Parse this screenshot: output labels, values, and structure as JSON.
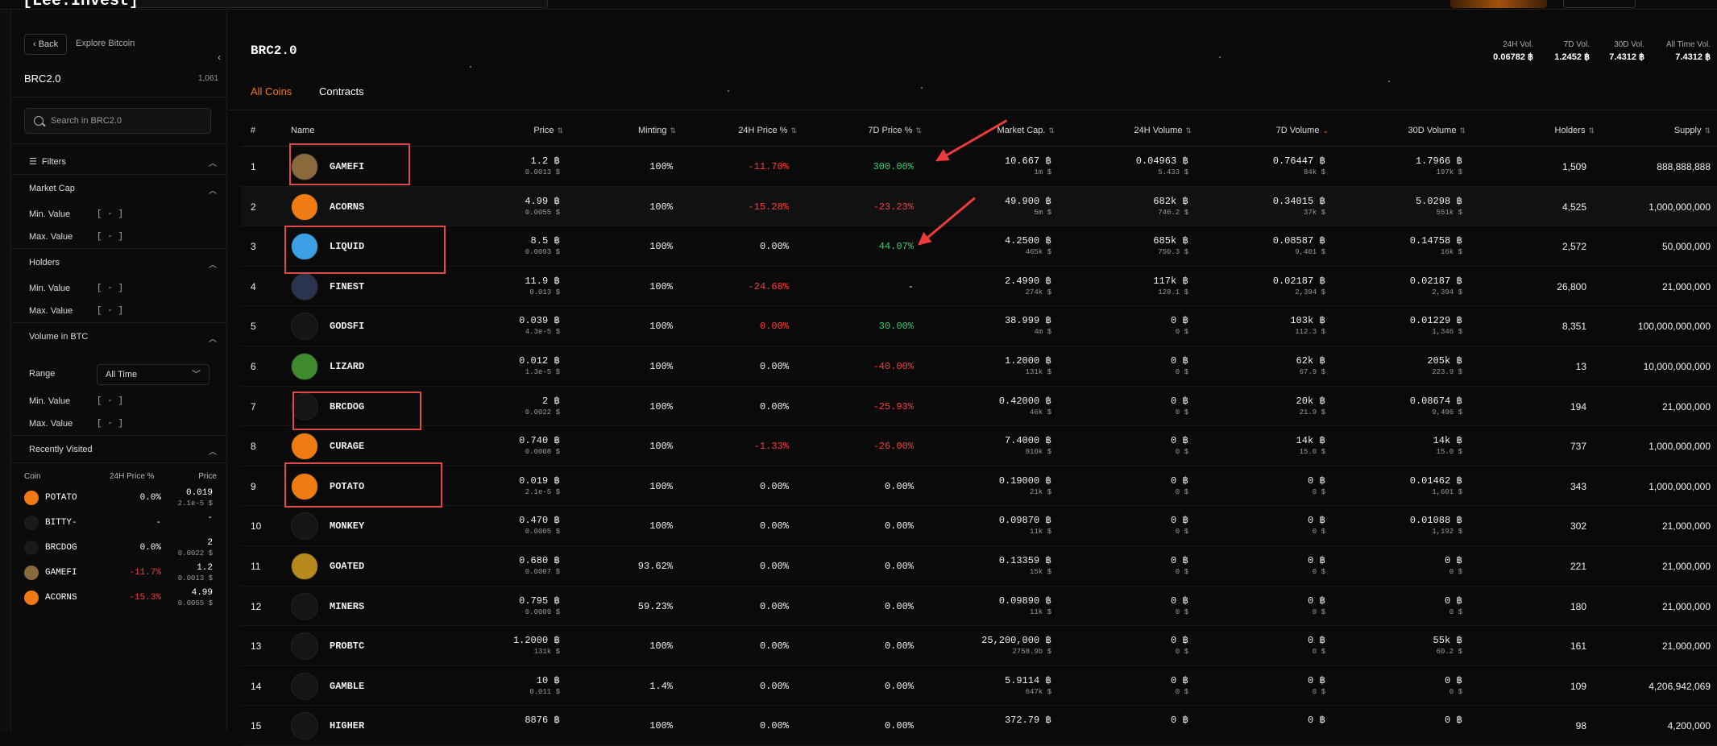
{
  "topbar": {
    "logo": "[Lee.Invest]"
  },
  "sidebar": {
    "back_label": "‹ Back",
    "explore_label": "Explore Bitcoin",
    "title": "BRC2.0",
    "count": "1,061",
    "search_placeholder": "Search in BRC2.0",
    "filters_label": "Filters",
    "market_cap_label": "Market Cap",
    "holders_label": "Holders",
    "volume_label": "Volume in BTC",
    "min_label": "Min. Value",
    "max_label": "Max. Value",
    "bracket_value": "[ - ]",
    "range_label": "Range",
    "range_value": "All Time",
    "recently_visited_label": "Recently Visited",
    "rv_headers": {
      "coin": "Coin",
      "pct": "24H Price %",
      "price": "Price"
    },
    "recent": [
      {
        "name": "POTATO",
        "pct": "0.0%",
        "price": "0.019",
        "sub": "2.1e-5 $",
        "icon_color": "#f07b12",
        "pct_color": "#ffffff"
      },
      {
        "name": "BITTY-",
        "pct": "-",
        "price": "-",
        "sub": "",
        "icon_color": "#1a1a1a",
        "pct_color": "#ffffff"
      },
      {
        "name": "BRCDOG",
        "pct": "0.0%",
        "price": "2",
        "sub": "0.0022 $",
        "icon_color": "#1a1a1a",
        "pct_color": "#ffffff"
      },
      {
        "name": "GAMEFI",
        "pct": "-11.7%",
        "price": "1.2",
        "sub": "0.0013 $",
        "icon_color": "#8a6a3c",
        "pct_color": "#ff3b3b"
      },
      {
        "name": "ACORNS",
        "pct": "-15.3%",
        "price": "4.99",
        "sub": "0.0055 $",
        "icon_color": "#f07b12",
        "pct_color": "#ff3b3b"
      }
    ]
  },
  "main": {
    "title": "BRC2.0",
    "stats": [
      {
        "label": "24H Vol.",
        "value": "0.06782 ฿"
      },
      {
        "label": "7D Vol.",
        "value": "1.2452 ฿"
      },
      {
        "label": "30D Vol.",
        "value": "7.4312 ฿"
      },
      {
        "label": "All Time Vol.",
        "value": "7.4312 ฿"
      }
    ],
    "tabs": [
      {
        "label": "All Coins"
      },
      {
        "label": "Contracts"
      }
    ],
    "headers": {
      "num": "#",
      "name": "Name",
      "price": "Price",
      "minting": "Minting",
      "p24": "24H Price %",
      "p7": "7D Price %",
      "mcap": "Market Cap.",
      "v24": "24H Volume",
      "v7": "7D Volume",
      "v30": "30D Volume",
      "holders": "Holders",
      "supply": "Supply"
    },
    "rows": [
      {
        "n": "1",
        "name": "GAMEFI",
        "price": "1.2 ฿",
        "price_sub": "0.0013 $",
        "mint": "100%",
        "p24": "-11.70%",
        "p24c": "red",
        "p7": "300.00%",
        "p7c": "green",
        "mcap": "10.667 ฿",
        "mcap_sub": "1m $",
        "v24": "0.04963 ฿",
        "v24_sub": "5.433 $",
        "v7": "0.76447 ฿",
        "v7_sub": "84k $",
        "v30": "1.7966 ฿",
        "v30_sub": "197k $",
        "holders": "1,509",
        "supply": "888,888,888",
        "icon": "#8a6a3c"
      },
      {
        "n": "2",
        "name": "ACORNS",
        "price": "4.99 ฿",
        "price_sub": "0.0055 $",
        "mint": "100%",
        "p24": "-15.28%",
        "p24c": "red",
        "p7": "-23.23%",
        "p7c": "red",
        "mcap": "49.900 ฿",
        "mcap_sub": "5m $",
        "v24": "682k ฿",
        "v24_sub": "746.2 $",
        "v7": "0.34015 ฿",
        "v7_sub": "37k $",
        "v30": "5.0298 ฿",
        "v30_sub": "551k $",
        "holders": "4,525",
        "supply": "1,000,000,000",
        "icon": "#f07b12"
      },
      {
        "n": "3",
        "name": "LIQUID",
        "price": "8.5 ฿",
        "price_sub": "0.0093 $",
        "mint": "100%",
        "p24": "0.00%",
        "p24c": "",
        "p7": "44.07%",
        "p7c": "green",
        "mcap": "4.2500 ฿",
        "mcap_sub": "465k $",
        "v24": "685k ฿",
        "v24_sub": "750.3 $",
        "v7": "0.08587 ฿",
        "v7_sub": "9,401 $",
        "v30": "0.14758 ฿",
        "v30_sub": "16k $",
        "holders": "2,572",
        "supply": "50,000,000",
        "icon": "#3ba0e6"
      },
      {
        "n": "4",
        "name": "FINEST",
        "price": "11.9 ฿",
        "price_sub": "0.013 $",
        "mint": "100%",
        "p24": "-24.68%",
        "p24c": "red",
        "p7": "-",
        "p7c": "",
        "mcap": "2.4990 ฿",
        "mcap_sub": "274k $",
        "v24": "117k ฿",
        "v24_sub": "128.1 $",
        "v7": "0.02187 ฿",
        "v7_sub": "2,394 $",
        "v30": "0.02187 ฿",
        "v30_sub": "2,394 $",
        "holders": "26,800",
        "supply": "21,000,000",
        "icon": "#2a3350"
      },
      {
        "n": "5",
        "name": "GODSFI",
        "price": "0.039 ฿",
        "price_sub": "4.3e-5 $",
        "mint": "100%",
        "p24": "0.00%",
        "p24c": "red",
        "p7": "30.00%",
        "p7c": "green",
        "mcap": "38.999 ฿",
        "mcap_sub": "4m $",
        "v24": "0 ฿",
        "v24_sub": "0 $",
        "v7": "103k ฿",
        "v7_sub": "112.3 $",
        "v30": "0.01229 ฿",
        "v30_sub": "1,346 $",
        "holders": "8,351",
        "supply": "100,000,000,000",
        "icon": "#151515"
      },
      {
        "n": "6",
        "name": "LIZARD",
        "price": "0.012 ฿",
        "price_sub": "1.3e-5 $",
        "mint": "100%",
        "p24": "0.00%",
        "p24c": "",
        "p7": "-40.00%",
        "p7c": "red",
        "mcap": "1.2000 ฿",
        "mcap_sub": "131k $",
        "v24": "0 ฿",
        "v24_sub": "0 $",
        "v7": "62k ฿",
        "v7_sub": "67.9 $",
        "v30": "205k ฿",
        "v30_sub": "223.9 $",
        "holders": "13",
        "supply": "10,000,000,000",
        "icon": "#3e8a2c"
      },
      {
        "n": "7",
        "name": "BRCDOG",
        "price": "2 ฿",
        "price_sub": "0.0022 $",
        "mint": "100%",
        "p24": "0.00%",
        "p24c": "",
        "p7": "-25.93%",
        "p7c": "red",
        "mcap": "0.42000 ฿",
        "mcap_sub": "46k $",
        "v24": "0 ฿",
        "v24_sub": "0 $",
        "v7": "20k ฿",
        "v7_sub": "21.9 $",
        "v30": "0.08674 ฿",
        "v30_sub": "9,496 $",
        "holders": "194",
        "supply": "21,000,000",
        "icon": "#151515"
      },
      {
        "n": "8",
        "name": "CURAGE",
        "price": "0.740 ฿",
        "price_sub": "0.0008 $",
        "mint": "100%",
        "p24": "-1.33%",
        "p24c": "red",
        "p7": "-26.00%",
        "p7c": "red",
        "mcap": "7.4000 ฿",
        "mcap_sub": "810k $",
        "v24": "0 ฿",
        "v24_sub": "0 $",
        "v7": "14k ฿",
        "v7_sub": "15.0 $",
        "v30": "14k ฿",
        "v30_sub": "15.0 $",
        "holders": "737",
        "supply": "1,000,000,000",
        "icon": "#f07b12"
      },
      {
        "n": "9",
        "name": "POTATO",
        "price": "0.019 ฿",
        "price_sub": "2.1e-5 $",
        "mint": "100%",
        "p24": "0.00%",
        "p24c": "",
        "p7": "0.00%",
        "p7c": "",
        "mcap": "0.19000 ฿",
        "mcap_sub": "21k $",
        "v24": "0 ฿",
        "v24_sub": "0 $",
        "v7": "0 ฿",
        "v7_sub": "0 $",
        "v30": "0.01462 ฿",
        "v30_sub": "1,601 $",
        "holders": "343",
        "supply": "1,000,000,000",
        "icon": "#f07b12"
      },
      {
        "n": "10",
        "name": "MONKEY",
        "price": "0.470 ฿",
        "price_sub": "0.0005 $",
        "mint": "100%",
        "p24": "0.00%",
        "p24c": "",
        "p7": "0.00%",
        "p7c": "",
        "mcap": "0.09870 ฿",
        "mcap_sub": "11k $",
        "v24": "0 ฿",
        "v24_sub": "0 $",
        "v7": "0 ฿",
        "v7_sub": "0 $",
        "v30": "0.01088 ฿",
        "v30_sub": "1,192 $",
        "holders": "302",
        "supply": "21,000,000",
        "icon": "#151515"
      },
      {
        "n": "11",
        "name": "GOATED",
        "price": "0.680 ฿",
        "price_sub": "0.0007 $",
        "mint": "93.62%",
        "p24": "0.00%",
        "p24c": "",
        "p7": "0.00%",
        "p7c": "",
        "mcap": "0.13359 ฿",
        "mcap_sub": "15k $",
        "v24": "0 ฿",
        "v24_sub": "0 $",
        "v7": "0 ฿",
        "v7_sub": "0 $",
        "v30": "0 ฿",
        "v30_sub": "0 $",
        "holders": "221",
        "supply": "21,000,000",
        "icon": "#b88a1e"
      },
      {
        "n": "12",
        "name": "MINERS",
        "price": "0.795 ฿",
        "price_sub": "0.0009 $",
        "mint": "59.23%",
        "p24": "0.00%",
        "p24c": "",
        "p7": "0.00%",
        "p7c": "",
        "mcap": "0.09890 ฿",
        "mcap_sub": "11k $",
        "v24": "0 ฿",
        "v24_sub": "0 $",
        "v7": "0 ฿",
        "v7_sub": "0 $",
        "v30": "0 ฿",
        "v30_sub": "0 $",
        "holders": "180",
        "supply": "21,000,000",
        "icon": "#151515"
      },
      {
        "n": "13",
        "name": "PROBTC",
        "price": "1.2000 ฿",
        "price_sub": "131k $",
        "mint": "100%",
        "p24": "0.00%",
        "p24c": "",
        "p7": "0.00%",
        "p7c": "",
        "mcap": "25,200,000 ฿",
        "mcap_sub": "2758.9b $",
        "v24": "0 ฿",
        "v24_sub": "0 $",
        "v7": "0 ฿",
        "v7_sub": "0 $",
        "v30": "55k ฿",
        "v30_sub": "60.2 $",
        "holders": "161",
        "supply": "21,000,000",
        "icon": "#151515"
      },
      {
        "n": "14",
        "name": "GAMBLE",
        "price": "10 ฿",
        "price_sub": "0.011 $",
        "mint": "1.4%",
        "p24": "0.00%",
        "p24c": "",
        "p7": "0.00%",
        "p7c": "",
        "mcap": "5.9114 ฿",
        "mcap_sub": "647k $",
        "v24": "0 ฿",
        "v24_sub": "0 $",
        "v7": "0 ฿",
        "v7_sub": "0 $",
        "v30": "0 ฿",
        "v30_sub": "0 $",
        "holders": "109",
        "supply": "4,206,942,069",
        "icon": "#151515"
      },
      {
        "n": "15",
        "name": "HIGHER",
        "price": "8876 ฿",
        "price_sub": "",
        "mint": "100%",
        "p24": "0.00%",
        "p24c": "",
        "p7": "0.00%",
        "p7c": "",
        "mcap": "372.79 ฿",
        "mcap_sub": "",
        "v24": "0 ฿",
        "v24_sub": "",
        "v7": "0 ฿",
        "v7_sub": "",
        "v30": "0 ฿",
        "v30_sub": "",
        "holders": "98",
        "supply": "4,200,000",
        "icon": "#151515"
      }
    ]
  },
  "colors": {
    "accent": "#f07b12",
    "negative": "#ff3b3b",
    "positive": "#2bd46e",
    "annotation": "#e24848"
  }
}
